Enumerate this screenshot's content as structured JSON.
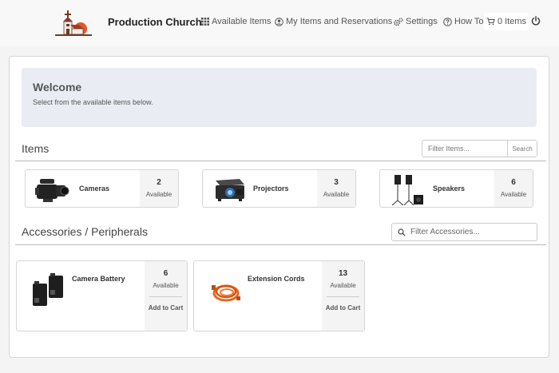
{
  "brand": {
    "name": "Production Church",
    "logo_icon": "church-icon"
  },
  "nav": {
    "available": {
      "label": "Available Items",
      "icon": "grid-icon"
    },
    "my_items": {
      "label": "My Items and Reservations",
      "icon": "user-circle-icon"
    },
    "settings": {
      "label": "Settings",
      "icon": "gears-icon"
    },
    "howto": {
      "label": "How To",
      "icon": "question-icon"
    },
    "cart": {
      "label": "0 Items",
      "icon": "cart-icon"
    },
    "logout_icon": "power-icon"
  },
  "welcome": {
    "title": "Welcome",
    "message": "Select from the available items below."
  },
  "items_section": {
    "title": "Items",
    "filter_placeholder": "Filter Items...",
    "search_label": "Search",
    "items": [
      {
        "name": "Cameras",
        "count": "2",
        "status": "Available",
        "icon": "video-camera-icon"
      },
      {
        "name": "Projectors",
        "count": "3",
        "status": "Available",
        "icon": "projector-icon"
      },
      {
        "name": "Speakers",
        "count": "6",
        "status": "Available",
        "icon": "speaker-icon"
      }
    ]
  },
  "accessories_section": {
    "title": "Accessories / Peripherals",
    "filter_placeholder": "Filter Accessories...",
    "items": [
      {
        "name": "Camera Battery",
        "count": "6",
        "status": "Available",
        "action": "Add to Cart",
        "icon": "battery-icon"
      },
      {
        "name": "Extension Cords",
        "count": "13",
        "status": "Available",
        "action": "Add to Cart",
        "icon": "cord-icon"
      }
    ]
  }
}
